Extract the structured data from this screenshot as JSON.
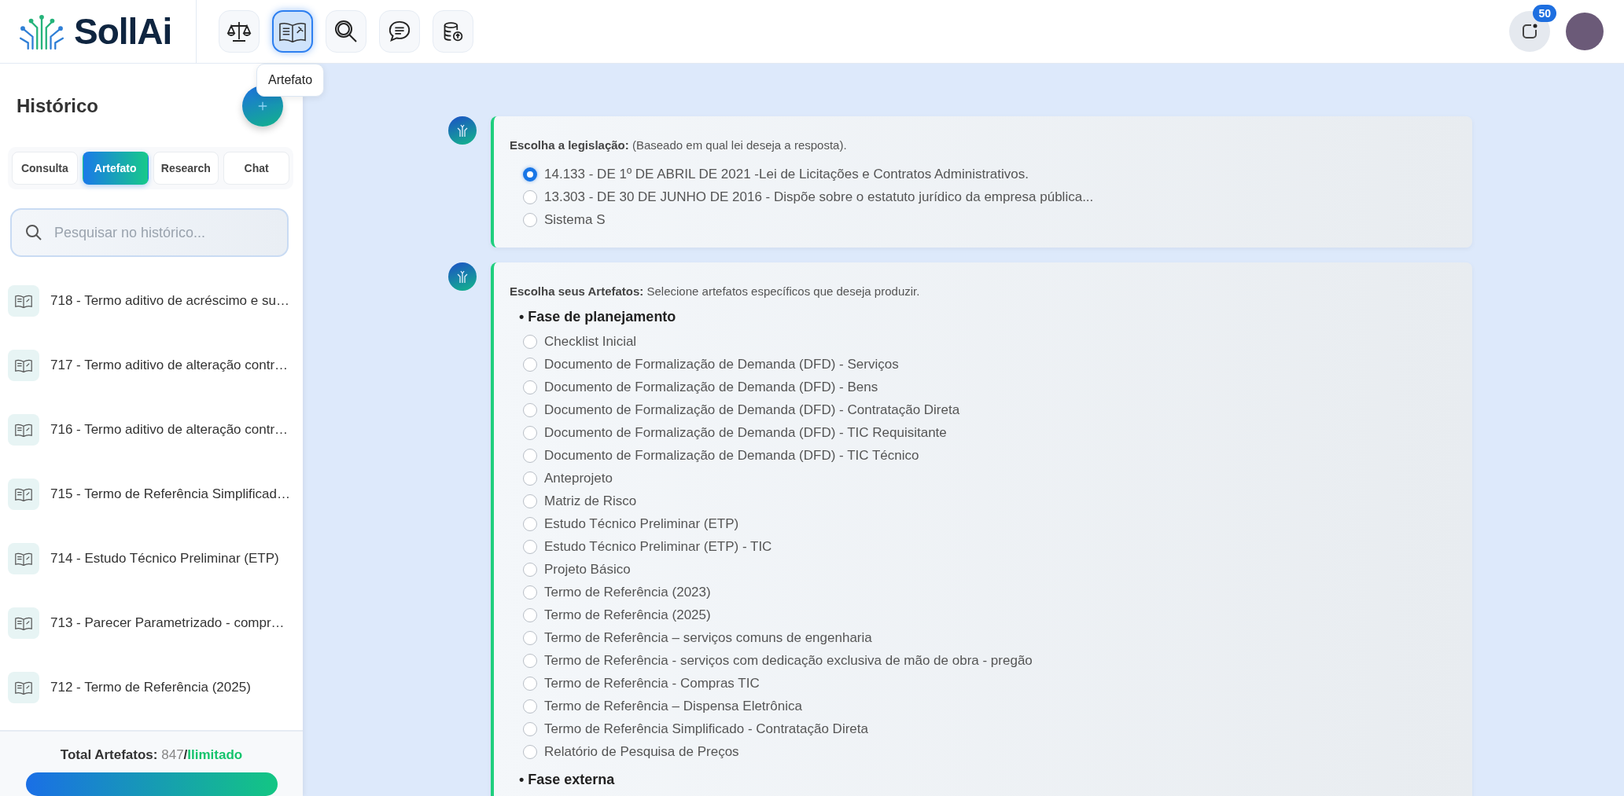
{
  "header": {
    "logo": "SollAi",
    "nav": [
      {
        "kind": "scales",
        "selected": false
      },
      {
        "kind": "book",
        "selected": true
      },
      {
        "kind": "search",
        "selected": false
      },
      {
        "kind": "chat",
        "selected": false
      },
      {
        "kind": "database",
        "selected": false
      }
    ],
    "tooltip": "Artefato",
    "notifications": {
      "badge": "50"
    }
  },
  "sidebar": {
    "title": "Histórico",
    "tabs": [
      {
        "label": "Consulta",
        "selected": false
      },
      {
        "label": "Artefato",
        "selected": true
      },
      {
        "label": "Research",
        "selected": false
      },
      {
        "label": "Chat",
        "selected": false
      }
    ],
    "search": {
      "placeholder": "Pesquisar no histórico..."
    },
    "items": [
      {
        "label": "718 - Termo aditivo de acréscimo e su…"
      },
      {
        "label": "717 - Termo aditivo de alteração contr…"
      },
      {
        "label": "716 - Termo aditivo de alteração contr…"
      },
      {
        "label": "715 - Termo de Referência Simplificad…"
      },
      {
        "label": "714 - Estudo Técnico Preliminar (ETP)"
      },
      {
        "label": "713 - Parecer Parametrizado - compr…"
      },
      {
        "label": "712 - Termo de Referência (2025)"
      }
    ],
    "footer": {
      "label": "Total Artefatos:",
      "count": "847",
      "separator": "/",
      "limit": "Ilimitado"
    }
  },
  "legislation": {
    "title": "Escolha a legislação:",
    "hint": "(Baseado em qual lei deseja a resposta).",
    "options": [
      {
        "label": "14.133 - DE 1º DE ABRIL DE 2021 -Lei de Licitações e Contratos Administrativos.",
        "selected": true
      },
      {
        "label": "13.303 - DE 30 DE JUNHO DE 2016 - Dispõe sobre o estatuto jurídico da empresa pública...",
        "selected": false
      },
      {
        "label": "Sistema S",
        "selected": false
      }
    ]
  },
  "artifacts": {
    "title": "Escolha seus Artefatos:",
    "hint": "Selecione artefatos específicos que deseja produzir.",
    "groups": [
      {
        "heading": "• Fase de planejamento",
        "options": [
          {
            "label": "Checklist Inicial",
            "selected": false
          },
          {
            "label": "Documento de Formalização de Demanda (DFD) - Serviços",
            "selected": false
          },
          {
            "label": "Documento de Formalização de Demanda (DFD) - Bens",
            "selected": false
          },
          {
            "label": "Documento de Formalização de Demanda (DFD) - Contratação Direta",
            "selected": false
          },
          {
            "label": "Documento de Formalização de Demanda (DFD) - TIC Requisitante",
            "selected": false
          },
          {
            "label": "Documento de Formalização de Demanda (DFD) - TIC Técnico",
            "selected": false
          },
          {
            "label": "Anteprojeto",
            "selected": false
          },
          {
            "label": "Matriz de Risco",
            "selected": false
          },
          {
            "label": "Estudo Técnico Preliminar (ETP)",
            "selected": false
          },
          {
            "label": "Estudo Técnico Preliminar (ETP) - TIC",
            "selected": false
          },
          {
            "label": "Projeto Básico",
            "selected": false
          },
          {
            "label": "Termo de Referência (2023)",
            "selected": false
          },
          {
            "label": "Termo de Referência (2025)",
            "selected": false
          },
          {
            "label": "Termo de Referência – serviços comuns de engenharia",
            "selected": false
          },
          {
            "label": "Termo de Referência - serviços com dedicação exclusiva de mão de obra - pregão",
            "selected": false
          },
          {
            "label": "Termo de Referência - Compras TIC",
            "selected": false
          },
          {
            "label": "Termo de Referência – Dispensa Eletrônica",
            "selected": false
          },
          {
            "label": "Termo de Referência Simplificado - Contratação Direta",
            "selected": false
          },
          {
            "label": "Relatório de Pesquisa de Preços",
            "selected": false
          }
        ]
      },
      {
        "heading": "• Fase externa"
      }
    ]
  }
}
